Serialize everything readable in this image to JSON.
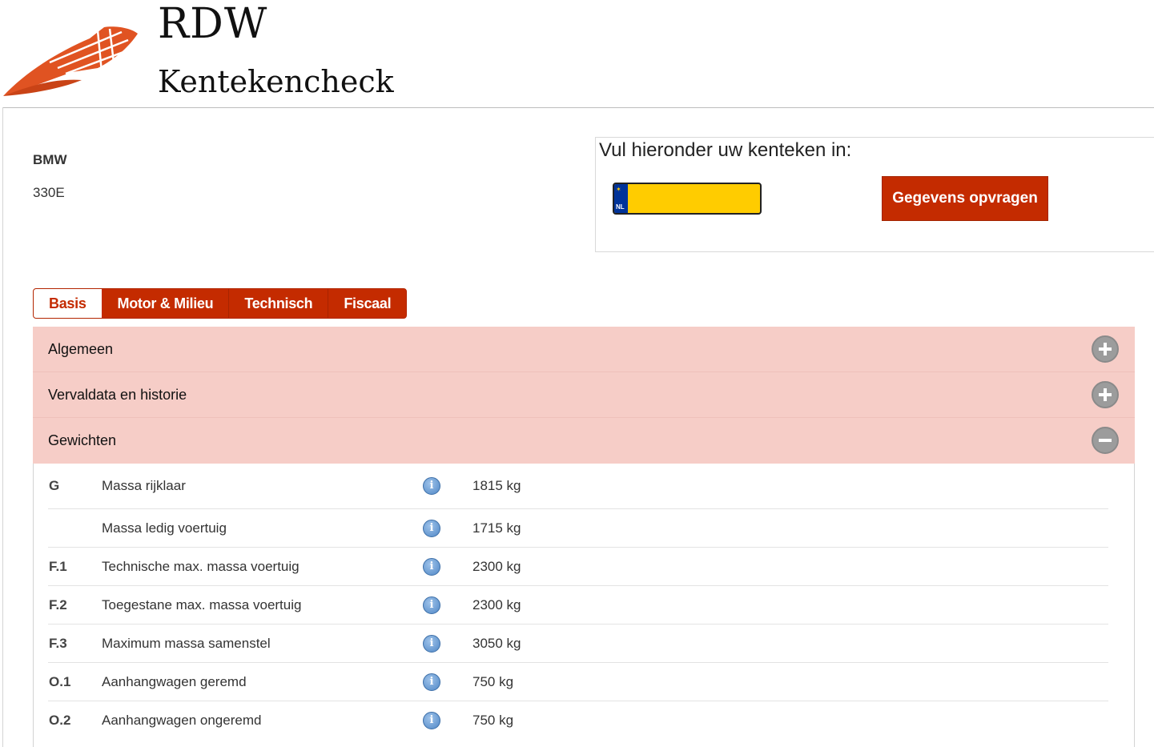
{
  "brand": {
    "title": "RDW",
    "subtitle": "Kentekencheck",
    "accent_color": "#c42b00",
    "logo_color": "#e05322"
  },
  "vehicle": {
    "make": "BMW",
    "model": "330E"
  },
  "search": {
    "label": "Vul hieronder uw kenteken in:",
    "plate_value": "",
    "plate_country": "NL",
    "submit_label": "Gegevens opvragen"
  },
  "tabs": [
    {
      "label": "Basis",
      "active": true
    },
    {
      "label": "Motor & Milieu",
      "active": false
    },
    {
      "label": "Technisch",
      "active": false
    },
    {
      "label": "Fiscaal",
      "active": false
    }
  ],
  "sections": [
    {
      "title": "Algemeen",
      "expanded": false,
      "icon": "plus-circle-icon"
    },
    {
      "title": "Vervaldata en historie",
      "expanded": false,
      "icon": "plus-circle-icon"
    },
    {
      "title": "Gewichten",
      "expanded": true,
      "icon": "minus-circle-icon"
    }
  ],
  "weights": [
    {
      "code": "G",
      "label": "Massa rijklaar",
      "value": "1815 kg"
    },
    {
      "code": "",
      "label": "Massa ledig voertuig",
      "value": "1715 kg"
    },
    {
      "code": "F.1",
      "label": "Technische max. massa voertuig",
      "value": "2300 kg"
    },
    {
      "code": "F.2",
      "label": "Toegestane max. massa voertuig",
      "value": "2300 kg"
    },
    {
      "code": "F.3",
      "label": "Maximum massa samenstel",
      "value": "3050 kg"
    },
    {
      "code": "O.1",
      "label": "Aanhangwagen geremd",
      "value": "750 kg"
    },
    {
      "code": "O.2",
      "label": "Aanhangwagen ongeremd",
      "value": "750 kg"
    }
  ]
}
